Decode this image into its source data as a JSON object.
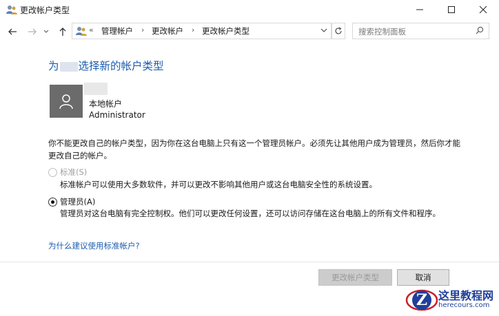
{
  "window": {
    "title": "更改帐户类型"
  },
  "nav": {
    "breadcrumb_prefix": "«",
    "breadcrumbs": [
      "管理帐户",
      "更改帐户",
      "更改帐户类型"
    ],
    "search_placeholder": "搜索控制面板"
  },
  "main": {
    "heading_prefix": "为",
    "heading_suffix": "选择新的帐户类型",
    "account": {
      "type": "本地帐户",
      "name": "Administrator"
    },
    "notice": "你不能更改自己的帐户类型，因为你在这台电脑上只有这一个管理员帐户。必须先让其他用户成为管理员，然后你才能更改自己的帐户。",
    "options": [
      {
        "label": "标准(S)",
        "description": "标准帐户可以使用大多数软件，并可以更改不影响其他用户或这台电脑安全性的系统设置。",
        "selected": false,
        "enabled": false
      },
      {
        "label": "管理员(A)",
        "description": "管理员对这台电脑有完全控制权。他们可以更改任何设置，还可以访问存储在这台电脑上的所有文件和程序。",
        "selected": true,
        "enabled": true
      }
    ],
    "help_link": "为什么建议使用标准帐户?"
  },
  "footer": {
    "primary_label": "更改帐户类型",
    "cancel_label": "取消"
  },
  "watermark": {
    "logo_letter": "Z",
    "title": "这里教程网",
    "url": "herecours.com"
  },
  "colors": {
    "link": "#1c5cb0",
    "heading": "#1f3c88",
    "avatar_bg": "#6b6b6b",
    "watermark": "#1f3f9a"
  }
}
